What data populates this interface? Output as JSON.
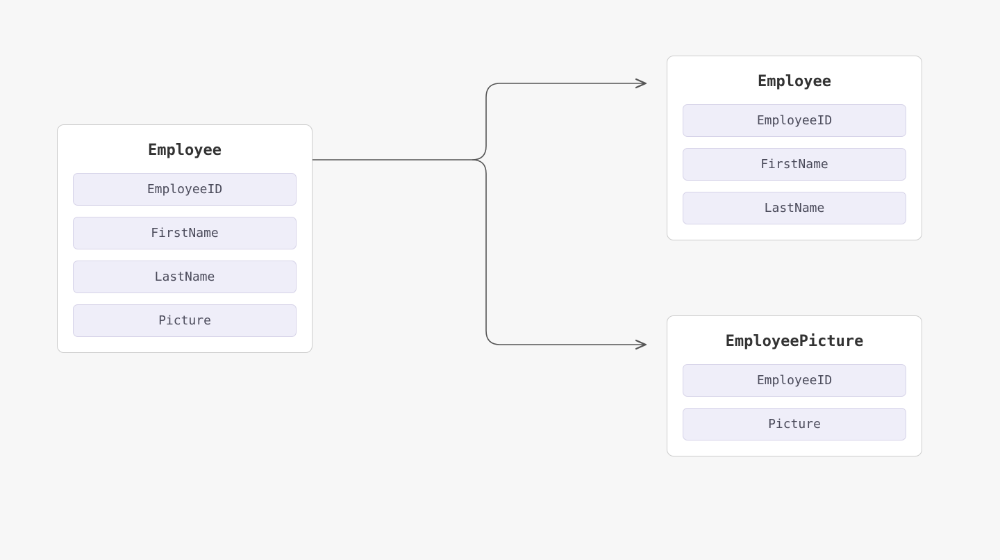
{
  "entities": {
    "left": {
      "title": "Employee",
      "fields": [
        "EmployeeID",
        "FirstName",
        "LastName",
        "Picture"
      ]
    },
    "topRight": {
      "title": "Employee",
      "fields": [
        "EmployeeID",
        "FirstName",
        "LastName"
      ]
    },
    "bottomRight": {
      "title": "EmployeePicture",
      "fields": [
        "EmployeeID",
        "Picture"
      ]
    }
  }
}
